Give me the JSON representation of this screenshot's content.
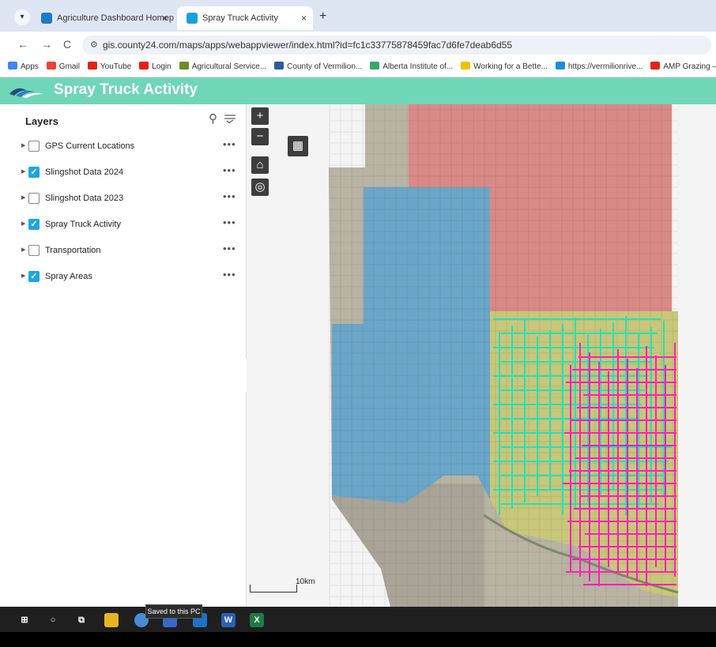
{
  "browser": {
    "tabs": [
      {
        "title": "Agriculture Dashboard Homep"
      },
      {
        "title": "Spray Truck Activity"
      }
    ],
    "tab_close": "×",
    "new_tab": "+",
    "url": "gis.county24.com/maps/apps/webappviewer/index.html?id=fc1c33775878459fac7d6fe7deab6d55",
    "nav": {
      "back": "←",
      "forward": "→",
      "reload": "C"
    },
    "bookmarks": [
      {
        "label": "Apps",
        "color": "#4285f4"
      },
      {
        "label": "Gmail",
        "color": "#ea4335"
      },
      {
        "label": "YouTube",
        "color": "#e62117"
      },
      {
        "label": "Login",
        "color": "#e62117"
      },
      {
        "label": "Agricultural Service...",
        "color": "#6b8e23"
      },
      {
        "label": "County of Vermilion...",
        "color": "#2a5aa0"
      },
      {
        "label": "Alberta Institute of...",
        "color": "#3aa76d"
      },
      {
        "label": "Working for a Bette...",
        "color": "#f2c200"
      },
      {
        "label": "https://vermilionrive...",
        "color": "#1b8fd6"
      },
      {
        "label": "AMP Grazing — U",
        "color": "#e62117"
      }
    ]
  },
  "app": {
    "title": "Spray Truck Activity",
    "header_color": "#6fd6b7"
  },
  "layers_panel": {
    "title": "Layers",
    "search_icon": "search-icon",
    "filter_icon": "filter-list-icon",
    "items": [
      {
        "label": "GPS Current Locations",
        "checked": false
      },
      {
        "label": "Slingshot Data 2024",
        "checked": true
      },
      {
        "label": "Slingshot Data 2023",
        "checked": false
      },
      {
        "label": "Spray Truck Activity",
        "checked": true
      },
      {
        "label": "Transportation",
        "checked": false
      },
      {
        "label": "Spray Areas",
        "checked": true
      }
    ],
    "more_label": "•••",
    "collapse_label": "‹"
  },
  "map": {
    "zoom_in": "+",
    "zoom_out": "−",
    "scale_label": "10km",
    "colors": {
      "north_area": "#d98a86",
      "west_area": "#6aa6c8",
      "southeast_area": "#c8c77a",
      "spray_lines_2024": "#26e0b8",
      "spray_lines_pink": "#ff1fb8"
    }
  },
  "taskbar": {
    "tooltip": "Saved to this PC"
  }
}
